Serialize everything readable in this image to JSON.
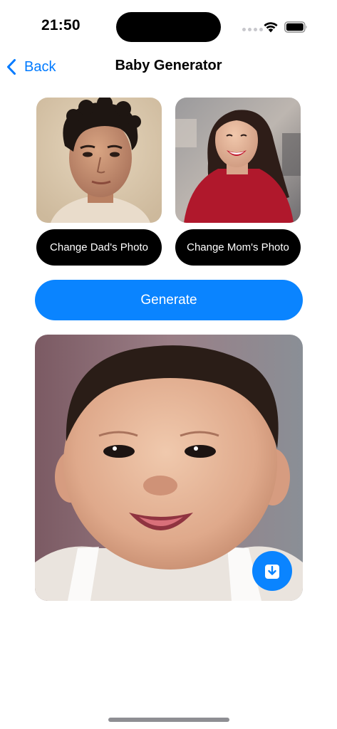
{
  "status_bar": {
    "time": "21:50"
  },
  "nav": {
    "back_label": "Back",
    "title": "Baby Generator"
  },
  "parents": {
    "dad_button_label": "Change Dad's Photo",
    "mom_button_label": "Change Mom's Photo"
  },
  "actions": {
    "generate_label": "Generate"
  },
  "icons": {
    "back": "chevron-left-icon",
    "download": "download-icon",
    "wifi": "wifi-icon",
    "battery": "battery-icon"
  },
  "colors": {
    "accent": "#0a84ff",
    "button_dark": "#000000",
    "background": "#ffffff"
  }
}
